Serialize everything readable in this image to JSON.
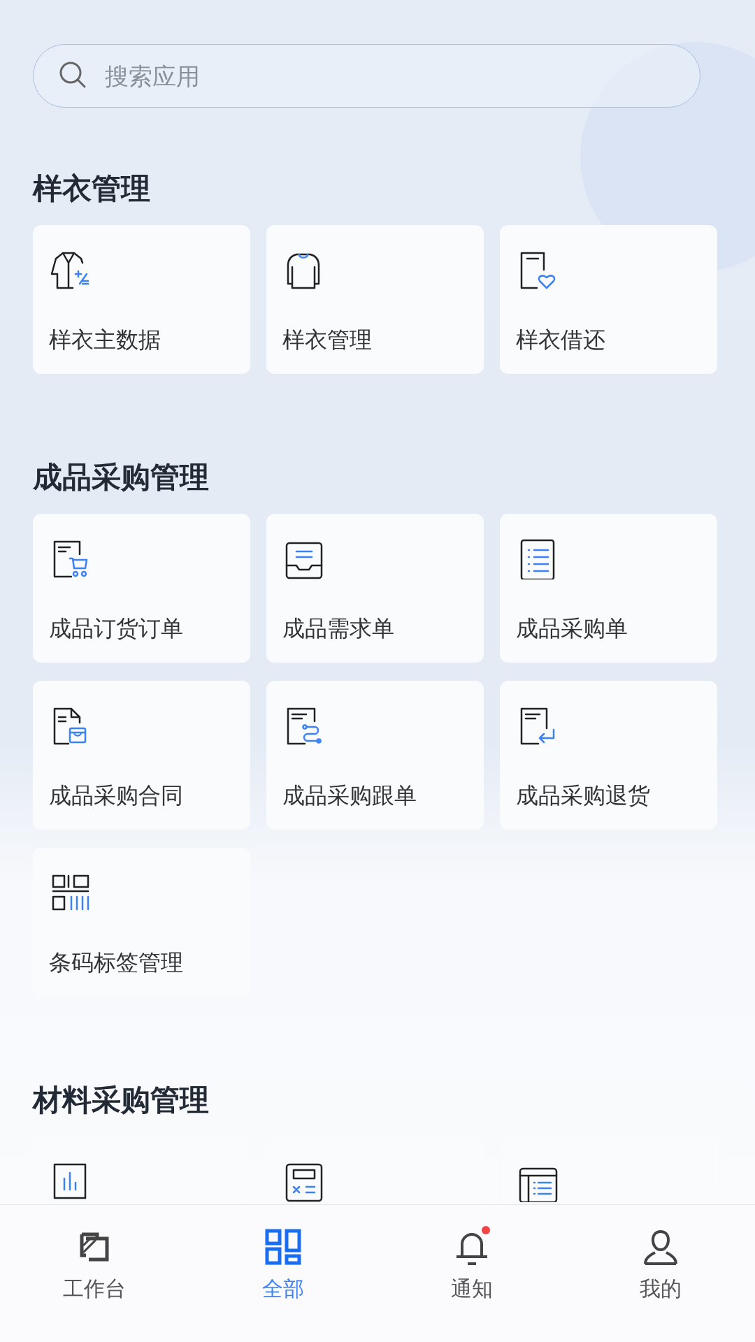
{
  "search": {
    "placeholder": "搜索应用"
  },
  "sections": [
    {
      "title": "样衣管理",
      "items": [
        {
          "kind": "card",
          "label": "样衣主数据"
        },
        {
          "kind": "card",
          "label": "样衣管理"
        },
        {
          "kind": "card",
          "label": "样衣借还"
        }
      ]
    },
    {
      "title": "成品采购管理",
      "items": [
        {
          "kind": "card",
          "label": "成品订货订单"
        },
        {
          "kind": "card",
          "label": "成品需求单"
        },
        {
          "kind": "card",
          "label": "成品采购单"
        },
        {
          "kind": "card",
          "label": "成品采购合同"
        },
        {
          "kind": "card",
          "label": "成品采购跟单"
        },
        {
          "kind": "card",
          "label": "成品采购退货"
        },
        {
          "kind": "card",
          "label": "条码标签管理"
        }
      ]
    },
    {
      "title": "材料采购管理",
      "items": [
        {
          "kind": "icon-only"
        },
        {
          "kind": "icon-only"
        },
        {
          "kind": "icon-only"
        }
      ]
    }
  ],
  "tab_bar": [
    {
      "label": "工作台",
      "selected": false,
      "dot": false
    },
    {
      "label": "全部",
      "selected": true,
      "dot": false
    },
    {
      "label": "通知",
      "selected": false,
      "dot": true
    },
    {
      "label": "我的",
      "selected": false,
      "dot": false
    }
  ]
}
